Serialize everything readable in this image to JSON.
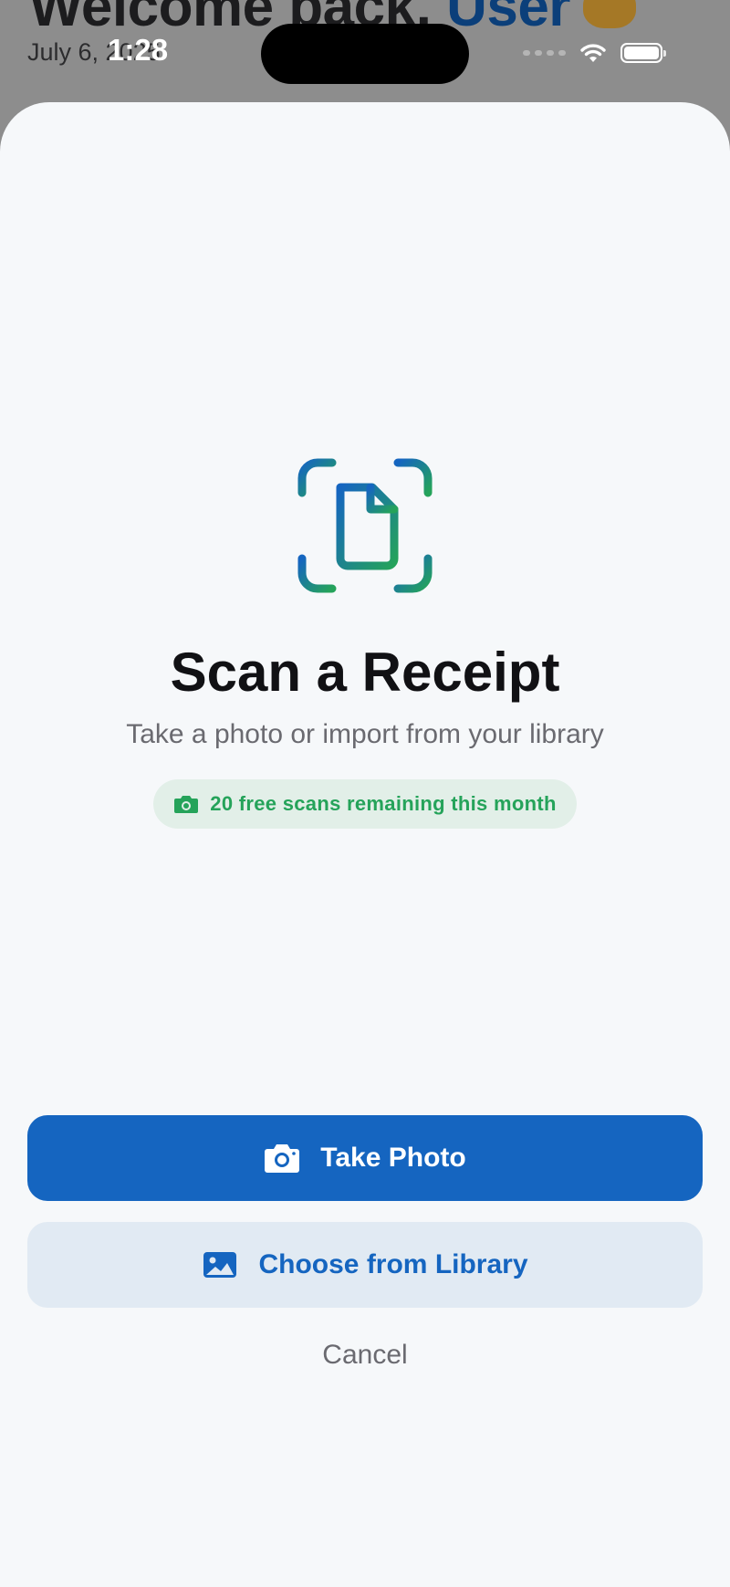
{
  "background": {
    "welcome_prefix": "Welcome back, ",
    "welcome_name": "User",
    "date": "July 6, 2025"
  },
  "status_bar": {
    "time": "1:28"
  },
  "sheet": {
    "title": "Scan a Receipt",
    "subtitle": "Take a photo or import from your library",
    "badge_text": "20 free scans remaining this month",
    "take_photo_label": "Take Photo",
    "choose_library_label": "Choose from Library",
    "cancel_label": "Cancel"
  },
  "colors": {
    "primary": "#1565c0",
    "secondary_bg": "#e1eaf3",
    "badge_bg": "#e2efe8",
    "badge_text": "#25a35a",
    "icon_gradient_start": "#1565c0",
    "icon_gradient_end": "#25a35a"
  },
  "icons": {
    "scan": "document-scan-icon",
    "badge": "camera-icon",
    "take_photo": "camera-icon",
    "library": "photo-icon"
  }
}
